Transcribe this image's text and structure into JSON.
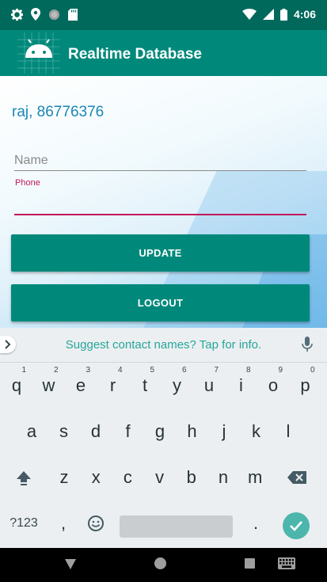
{
  "status_bar": {
    "time": "4:06",
    "left_icons": [
      "gear-icon",
      "location-pin-icon",
      "circle-icon",
      "sd-card-icon"
    ],
    "right_icons": [
      "wifi-icon",
      "signal-icon",
      "battery-icon"
    ]
  },
  "app_bar": {
    "title": "Realtime Database",
    "logo": "android-logo"
  },
  "content": {
    "user_info": "raj, 86776376",
    "name_placeholder": "Name",
    "name_value": "",
    "phone_label": "Phone",
    "phone_value": "",
    "update_label": "UPDATE",
    "logout_label": "LOGOUT"
  },
  "keyboard": {
    "suggestion": "Suggest contact names? Tap for info.",
    "row1": [
      {
        "k": "q",
        "h": "1"
      },
      {
        "k": "w",
        "h": "2"
      },
      {
        "k": "e",
        "h": "3"
      },
      {
        "k": "r",
        "h": "4"
      },
      {
        "k": "t",
        "h": "5"
      },
      {
        "k": "y",
        "h": "6"
      },
      {
        "k": "u",
        "h": "7"
      },
      {
        "k": "i",
        "h": "8"
      },
      {
        "k": "o",
        "h": "9"
      },
      {
        "k": "p",
        "h": "0"
      }
    ],
    "row2": [
      "a",
      "s",
      "d",
      "f",
      "g",
      "h",
      "j",
      "k",
      "l"
    ],
    "row3": [
      "z",
      "x",
      "c",
      "v",
      "b",
      "n",
      "m"
    ],
    "symbols_label": "?123",
    "comma": ",",
    "period": ".",
    "accent_color": "#4db6ac"
  },
  "colors": {
    "primary": "#00897b",
    "primary_dark": "#00695c",
    "accent": "#c2185b",
    "user_text": "#1a86b8"
  }
}
